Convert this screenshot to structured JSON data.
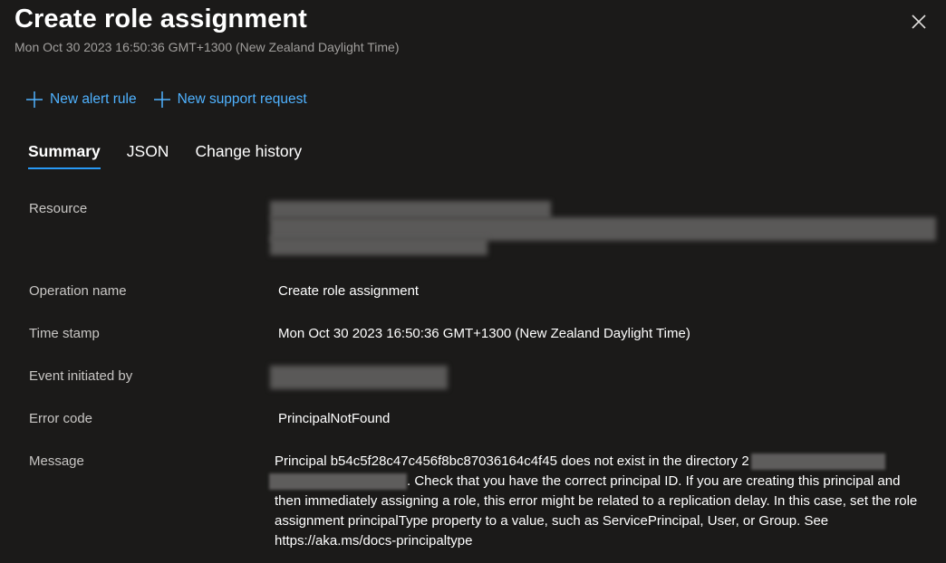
{
  "header": {
    "title": "Create role assignment",
    "subtitle": "Mon Oct 30 2023 16:50:36 GMT+1300 (New Zealand Daylight Time)"
  },
  "toolbar": {
    "new_alert_rule": "New alert rule",
    "new_support_request": "New support request"
  },
  "tabs": [
    {
      "label": "Summary",
      "active": true
    },
    {
      "label": "JSON",
      "active": false
    },
    {
      "label": "Change history",
      "active": false
    }
  ],
  "details": {
    "resource_label": "Resource",
    "operation_name_label": "Operation name",
    "operation_name_value": "Create role assignment",
    "time_stamp_label": "Time stamp",
    "time_stamp_value": "Mon Oct 30 2023 16:50:36 GMT+1300 (New Zealand Daylight Time)",
    "event_initiated_by_label": "Event initiated by",
    "error_code_label": "Error code",
    "error_code_value": "PrincipalNotFound",
    "message_label": "Message",
    "message_part1": "Principal b54c5f28c47c456f8bc87036164c4f45 does not exist in the directory 2",
    "message_part2": ". Check that you have the correct principal ID. If you are creating this principal and then immediately assigning a role, this error might be related to a replication delay. In this case, set the role assignment principalType property to a value, such as ServicePrincipal, User, or Group. See https://aka.ms/docs-principaltype"
  },
  "colors": {
    "background": "#1b1a19",
    "link": "#4fb2ff",
    "tab_underline": "#2899f5",
    "label_text": "#c8c6c4",
    "subtitle_text": "#a19f9d"
  },
  "icons": {
    "close": "close-icon",
    "add": "plus-icon"
  }
}
